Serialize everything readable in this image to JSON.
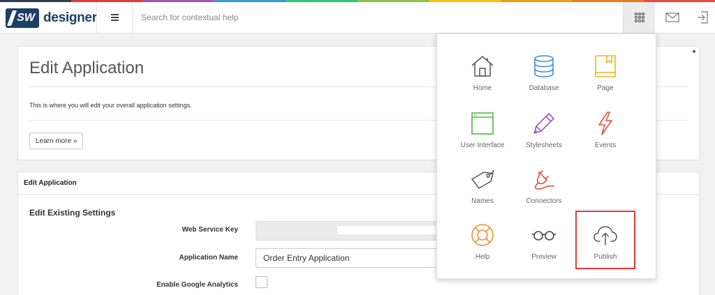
{
  "colors": {
    "rainbow": [
      "#2d3e50",
      "#e23a3a",
      "#9b59b6",
      "#3498db",
      "#2ecc71",
      "#8bc34a",
      "#f1c40f",
      "#f39c12",
      "#e67e22",
      "#e74c3c"
    ],
    "brand": "#1c3f66",
    "highlight": "#e53935"
  },
  "header": {
    "logo_badge": "SW",
    "logo_text": "designer",
    "search_placeholder": "Search for contextual help",
    "icons": [
      "menu-icon",
      "app-grid-icon",
      "mail-icon",
      "sign-out-icon"
    ]
  },
  "intro": {
    "title": "Edit Application",
    "description": "This is where you will edit your overall application settings.",
    "learn_more": "Learn more »",
    "pin_glyph": "✦"
  },
  "form": {
    "panel_title": "Edit Application",
    "section_title": "Edit Existing Settings",
    "web_service_key_label": "Web Service Key",
    "application_name_label": "Application Name",
    "application_name_value": "Order Entry Application",
    "analytics_label": "Enable Google Analytics"
  },
  "menu": {
    "home": "Home",
    "database": "Database",
    "page": "Page",
    "user_interface": "User Interface",
    "stylesheets": "Stylesheets",
    "events": "Events",
    "names": "Names",
    "connectors": "Connectors",
    "help": "Help",
    "preview": "Preview",
    "publish": "Publish"
  }
}
